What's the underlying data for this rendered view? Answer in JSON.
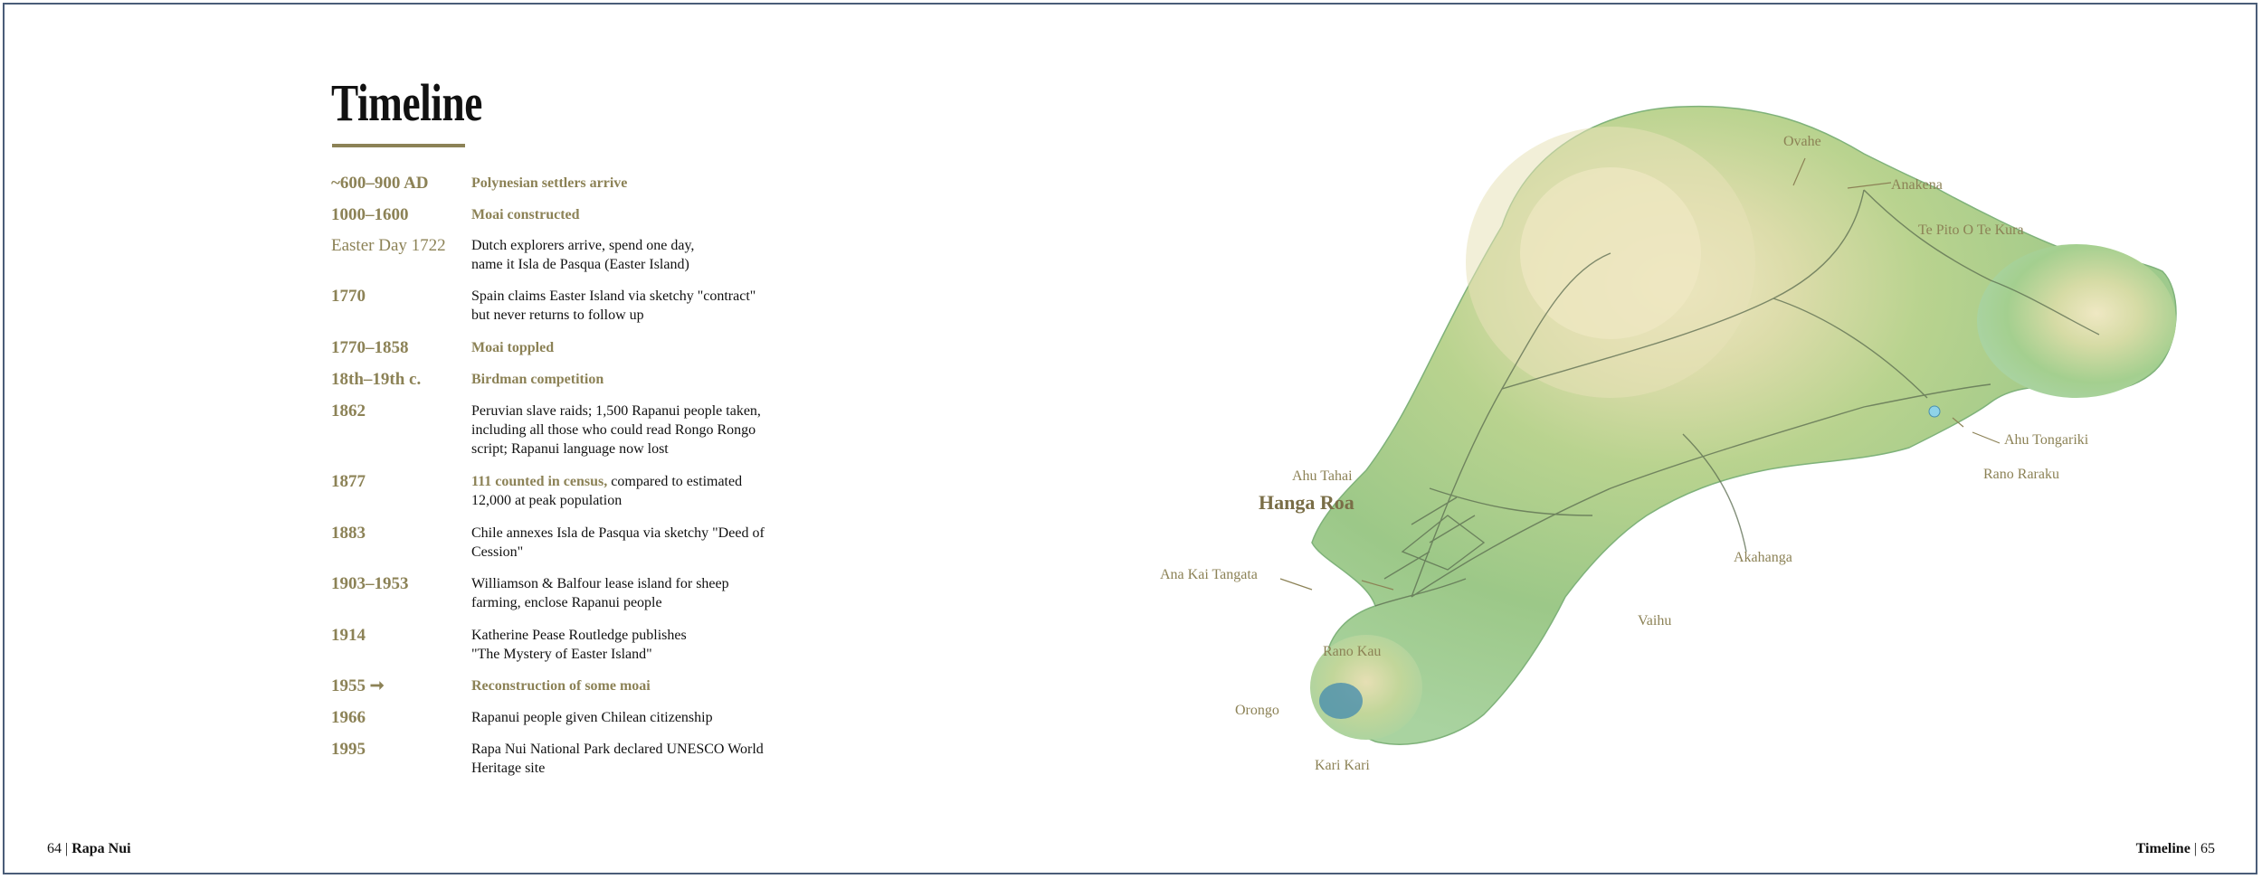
{
  "page": {
    "title": "Timeline",
    "footer_left_page": "64",
    "footer_left_text": "Rapa Nui",
    "footer_right_text": "Timeline",
    "footer_right_page": "65"
  },
  "timeline": [
    {
      "year": "~600–900 AD",
      "text": "Polynesian settlers arrive",
      "accent": true
    },
    {
      "year": "1000–1600",
      "text": "Moai constructed",
      "accent": true
    },
    {
      "year": "Easter Day 1722",
      "text": "Dutch explorers arrive, spend one day,",
      "text2": "name it Isla de Pasqua (Easter Island)"
    },
    {
      "year": "1770",
      "text": "Spain claims Easter Island via sketchy \"contract\"",
      "text2": "but never returns to follow up"
    },
    {
      "year": "1770–1858",
      "text": "Moai toppled",
      "accent": true
    },
    {
      "year": "18th–19th c.",
      "text": "Birdman competition",
      "accent": true
    },
    {
      "year": "1862",
      "text": "Peruvian slave raids; 1,500 Rapanui people taken,",
      "text2": "including all those who could read Rongo Rongo",
      "text3": "script; Rapanui language now lost"
    },
    {
      "year": "1877",
      "hl": "111 counted in census,",
      "text": " compared to estimated",
      "text2": "12,000 at peak population"
    },
    {
      "year": "1883",
      "text": "Chile annexes Isla de Pasqua via sketchy \"Deed of",
      "text2": "Cession\""
    },
    {
      "year": "1903–1953",
      "text": "Williamson & Balfour lease island for sheep",
      "text2": "farming, enclose Rapanui people"
    },
    {
      "year": "1914",
      "text": "Katherine Pease Routledge publishes",
      "text2": "\"The Mystery of Easter Island\""
    },
    {
      "year": "1955 ➞",
      "text": "Reconstruction of some moai",
      "accent": true
    },
    {
      "year": "1966",
      "text": "Rapanui people given Chilean citizenship"
    },
    {
      "year": "1995",
      "text": "Rapa Nui National Park declared UNESCO World",
      "text2": "Heritage site"
    }
  ],
  "map": {
    "places": {
      "ovahe": "Ovahe",
      "anakena": "Anakena",
      "te_pito": "Te Pito O Te Kura",
      "ahu_tongariki": "Ahu Tongariki",
      "rano_raraku": "Rano Raraku",
      "akahanga": "Akahanga",
      "vaihu": "Vaihu",
      "ahu_tahai": "Ahu Tahai",
      "hanga_roa": "Hanga Roa",
      "ana_kai_tangata": "Ana Kai Tangata",
      "rano_kau": "Rano Kau",
      "orongo": "Orongo",
      "kari_kari": "Kari Kari"
    },
    "colors": {
      "land_low": "#a7cf9c",
      "land_mid": "#8fbf7a",
      "land_high": "#cfd9a6",
      "peak": "#efe8c3",
      "road": "#5a6b4f",
      "label": "#8c8256",
      "crater_lake": "#4a8fae"
    }
  }
}
